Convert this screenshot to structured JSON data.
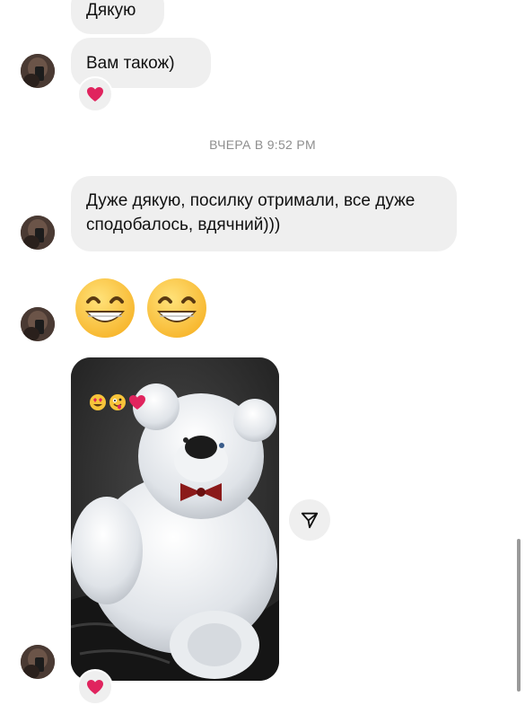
{
  "messages": {
    "msg1_text": "Дякую",
    "msg2_text": "Вам також)",
    "msg3_text": "Дуже дякую, посилку отримали, все дуже сподобалось, вдячний)))",
    "emoji_message": "😁😁"
  },
  "timestamp": "ВЧЕРА В 9:52 PM",
  "reactions": {
    "heart": "❤️"
  },
  "media": {
    "stickers": "😍🤪❤️"
  },
  "colors": {
    "bubble": "#efefef",
    "timestamp": "#8e8e8e",
    "heart": "#e0245e"
  },
  "icons": {
    "share": "paper-plane-icon",
    "heart": "heart-icon",
    "avatar": "avatar"
  }
}
